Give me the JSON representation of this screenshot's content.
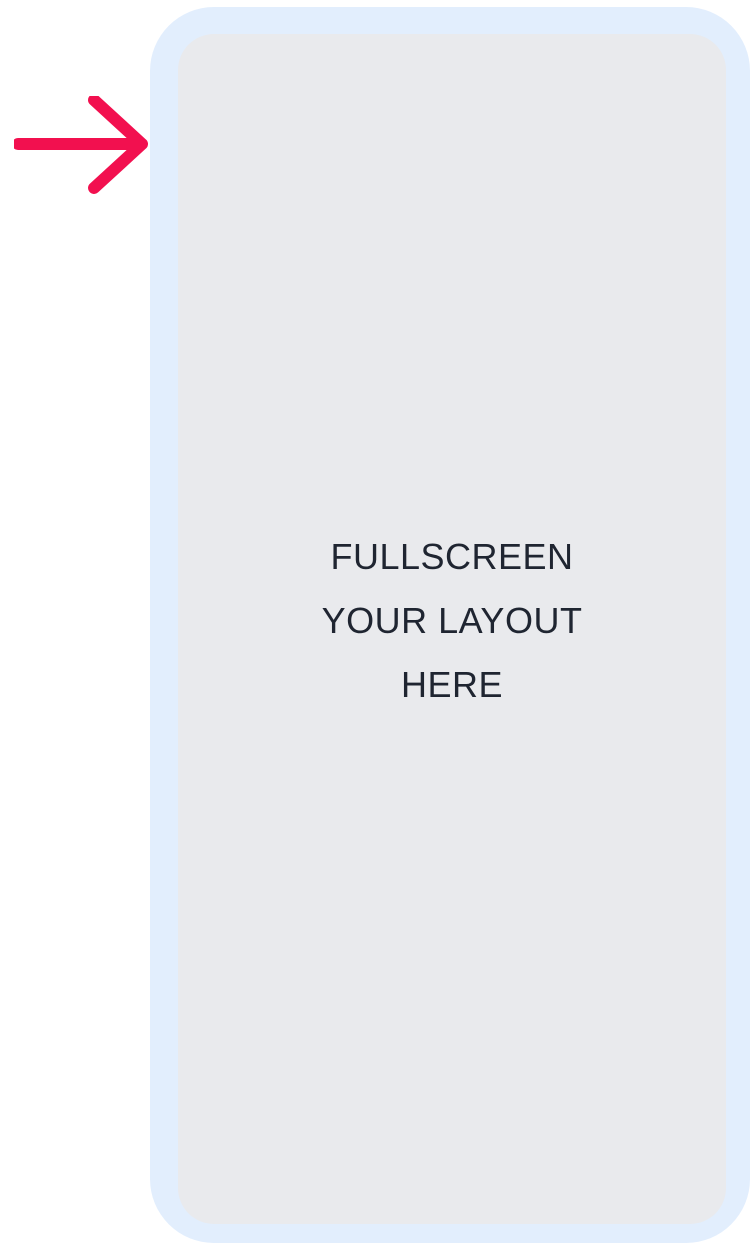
{
  "arrow": {
    "icon": "arrow-right-icon",
    "color": "#f2104f"
  },
  "phone": {
    "frame_color": "#e2eefd",
    "screen_color": "#e9eaed",
    "text_color": "#1f2531",
    "lines": {
      "primary": "FULLSCREEN",
      "secondary_1": "YOUR LAYOUT",
      "secondary_2": "HERE"
    }
  }
}
